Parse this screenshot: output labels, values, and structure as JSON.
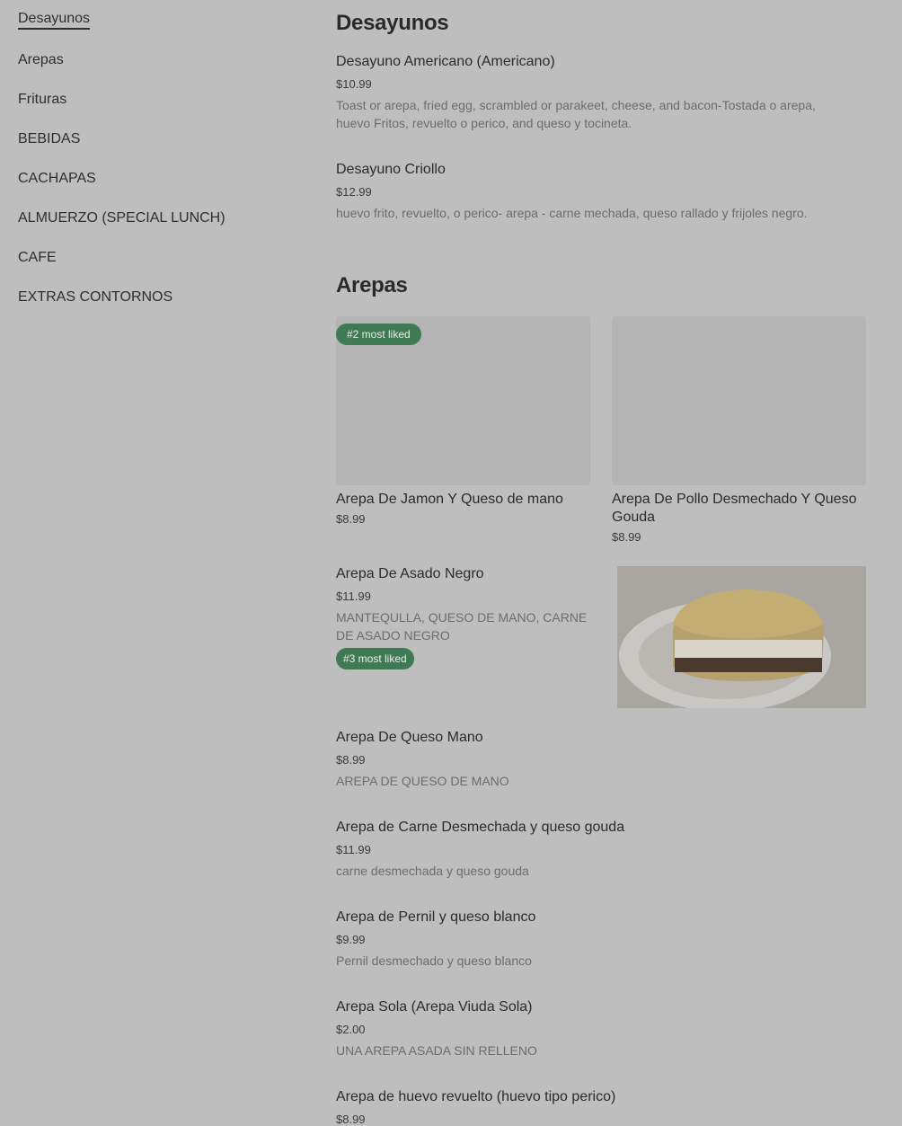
{
  "sidebar": {
    "items": [
      {
        "label": "Desayunos",
        "active": true
      },
      {
        "label": "Arepas"
      },
      {
        "label": "Frituras"
      },
      {
        "label": "BEBIDAS"
      },
      {
        "label": "CACHAPAS"
      },
      {
        "label": "ALMUERZO (SPECIAL LUNCH)"
      },
      {
        "label": "CAFE"
      },
      {
        "label": "EXTRAS CONTORNOS"
      }
    ]
  },
  "sections": {
    "desayunos": {
      "title": "Desayunos",
      "items": [
        {
          "name": "Desayuno Americano (Americano)",
          "price": "$10.99",
          "desc": "Toast or arepa, fried egg, scrambled or parakeet, cheese, and bacon-Tostada o arepa, huevo Fritos, revuelto o perico, and queso y tocineta."
        },
        {
          "name": "Desayuno Criollo",
          "price": "$12.99",
          "desc": "huevo frito, revuelto, o perico- arepa - carne mechada, queso rallado y frijoles negro."
        }
      ]
    },
    "arepas": {
      "title": "Arepas",
      "cards": [
        {
          "name": "Arepa De Jamon Y Queso de mano",
          "price": "$8.99",
          "badge": "#2 most liked"
        },
        {
          "name": "Arepa De Pollo Desmechado Y Queso Gouda",
          "price": "$8.99"
        }
      ],
      "featured": {
        "name": "Arepa De Asado Negro",
        "price": "$11.99",
        "desc": "MANTEQULLA, QUESO DE MANO, CARNE DE ASADO NEGRO",
        "badge": "#3 most liked"
      },
      "items": [
        {
          "name": "Arepa De Queso Mano",
          "price": "$8.99",
          "desc": "AREPA DE QUESO DE MANO"
        },
        {
          "name": "Arepa de Carne Desmechada y queso gouda",
          "price": "$11.99",
          "desc": "carne desmechada y queso gouda"
        },
        {
          "name": "Arepa de Pernil y queso blanco",
          "price": "$9.99",
          "desc": "Pernil desmechado y queso blanco"
        },
        {
          "name": "Arepa Sola (Arepa Viuda Sola)",
          "price": "$2.00",
          "desc": "UNA AREPA ASADA SIN RELLENO"
        },
        {
          "name": "Arepa de huevo revuelto (huevo tipo perico)",
          "price": "$8.99"
        }
      ]
    }
  }
}
